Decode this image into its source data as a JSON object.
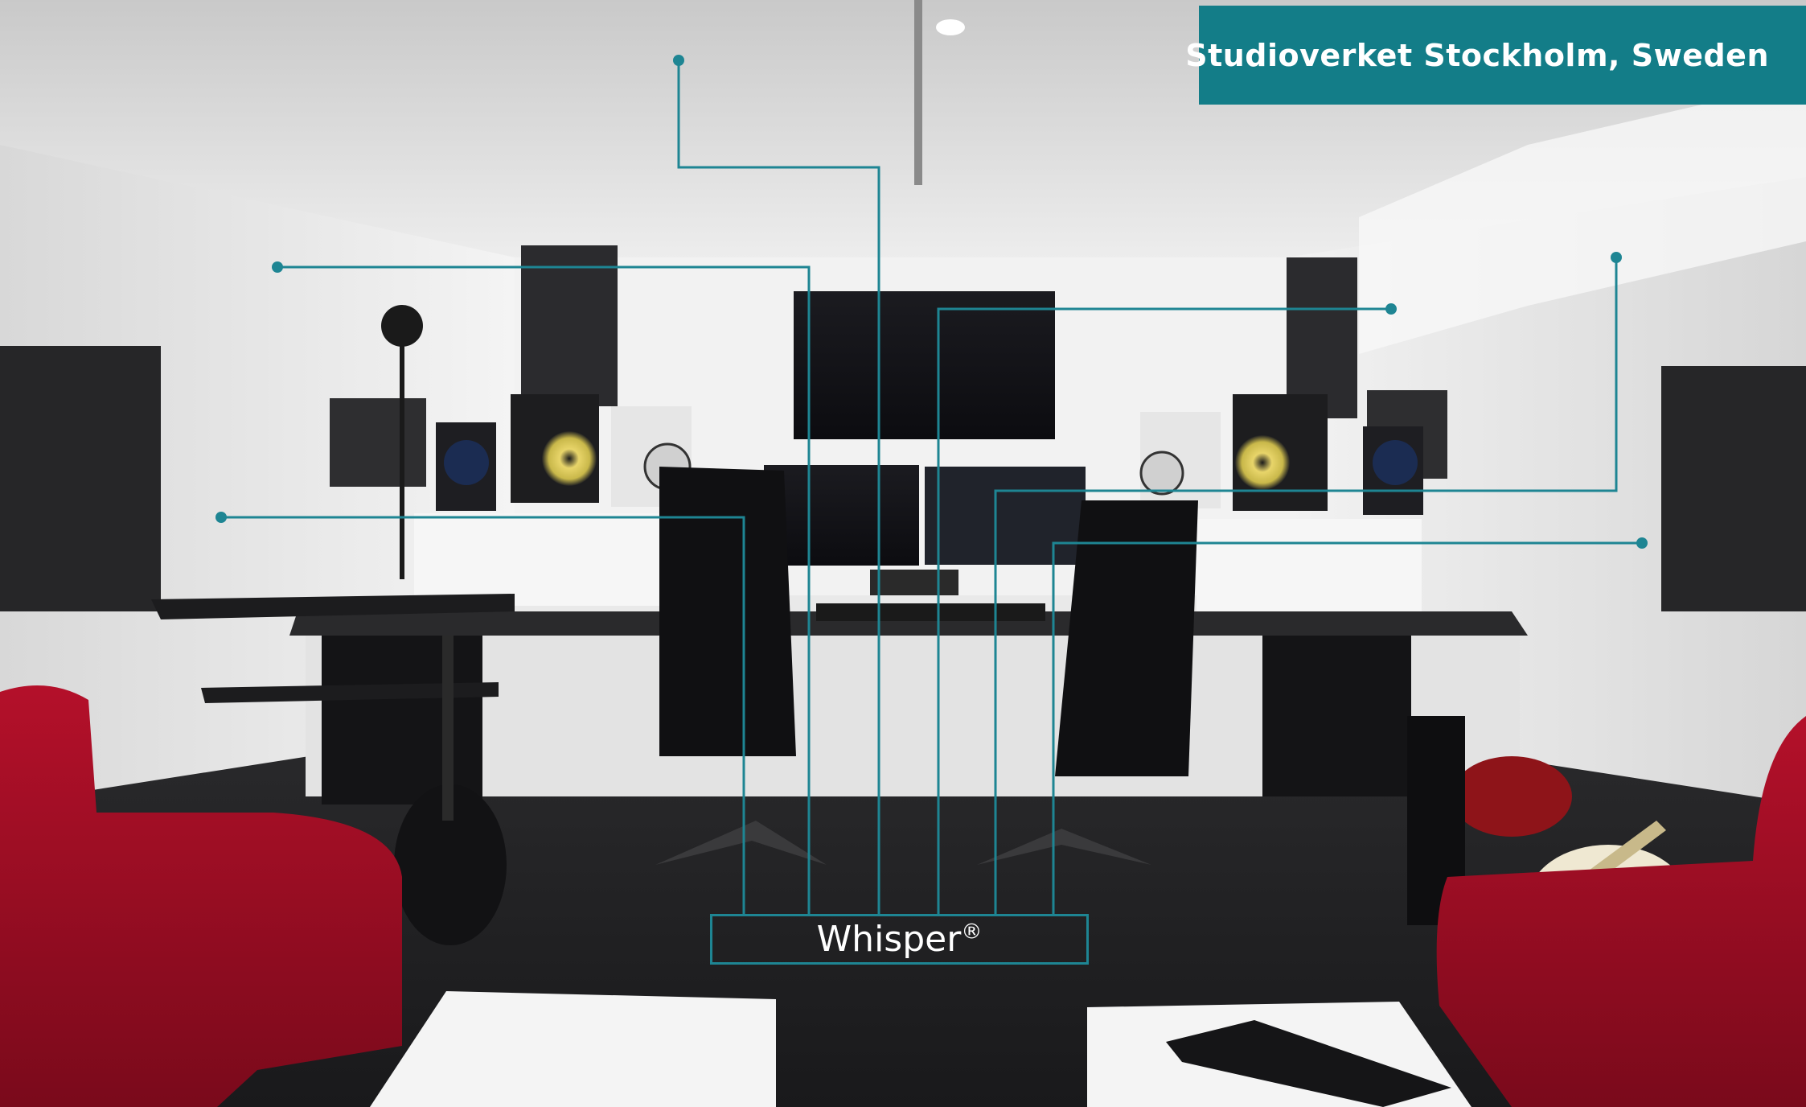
{
  "photo": {
    "subject": "music-studio-control-room",
    "label_color": "#137d88",
    "line_color": "#1e8593"
  },
  "location_badge": {
    "text": "Studioverket Stockholm, Sweden"
  },
  "product_label": {
    "name": "Whisper",
    "mark": "®"
  }
}
